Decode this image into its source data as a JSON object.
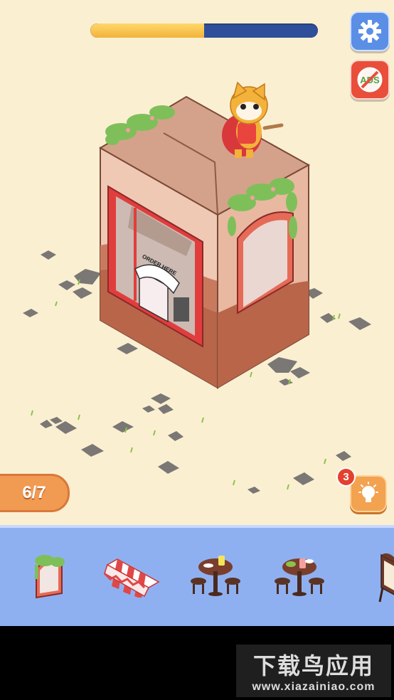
{
  "hud": {
    "progress_fraction": 0.5,
    "level_text": "6/7",
    "hint_count": "3",
    "settings_icon": "gear-icon",
    "noads_icon": "no-ads-icon",
    "noads_text": "ADS",
    "hint_icon": "lightbulb-icon"
  },
  "scene": {
    "sign_text": "ORDER HERE"
  },
  "tray": {
    "items": [
      {
        "name": "arched-window-with-vines"
      },
      {
        "name": "striped-awning"
      },
      {
        "name": "cafe-table-with-drinks"
      },
      {
        "name": "cafe-table-with-desserts"
      },
      {
        "name": "menu-board"
      }
    ]
  },
  "watermark": {
    "title": "下载鸟应用",
    "url": "www.xiazainiao.com"
  },
  "colors": {
    "background": "#fbefd2",
    "progress_fill": "#f2b23a",
    "progress_track": "#2f4f9a",
    "tray": "#8fb0f0",
    "accent_orange": "#f19a52"
  }
}
